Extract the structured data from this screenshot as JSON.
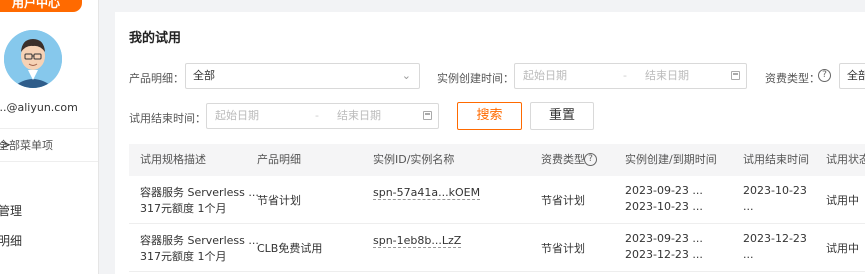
{
  "sidebar": {
    "badge": "用户中心",
    "email": "...@aliyun.com",
    "all_menu": "全部菜单项",
    "items": [
      "管理",
      "明细"
    ]
  },
  "main": {
    "title": "我的试用",
    "filters": {
      "product_label": "产品明细：",
      "product_value": "全部",
      "created_label": "实例创建时间：",
      "created_start": "起始日期",
      "created_end": "结束日期",
      "billing_label": "资费类型：",
      "billing_value": "全部",
      "ended_label": "试用结束时间：",
      "ended_start": "起始日期",
      "ended_end": "结束日期",
      "search": "搜索",
      "reset": "重置"
    },
    "table": {
      "headers": [
        "试用规格描述",
        "产品明细",
        "实例ID/实例名称",
        "资费类型",
        "实例创建/到期时间",
        "试用结束时间",
        "试用状态"
      ],
      "rows": [
        {
          "spec_line1": "容器服务 Serverless ...",
          "spec_line2": "317元额度 1个月",
          "product": "节省计划",
          "instance": "spn-57a41a...kOEM",
          "billing": "节省计划",
          "created": "2023-09-23 ...",
          "expires": "2023-10-23 ...",
          "ended_line1": "2023-10-23",
          "ended_line2": "...",
          "status": "试用中"
        },
        {
          "spec_line1": "容器服务 Serverless ...",
          "spec_line2": "317元额度 1个月",
          "product": "CLB免费试用",
          "instance": "spn-1eb8b...LzZ",
          "billing": "节省计划",
          "created": "2023-09-23 ...",
          "expires": "2023-12-23 ...",
          "ended_line1": "2023-12-23",
          "ended_line2": "...",
          "status": "试用中"
        }
      ]
    }
  }
}
